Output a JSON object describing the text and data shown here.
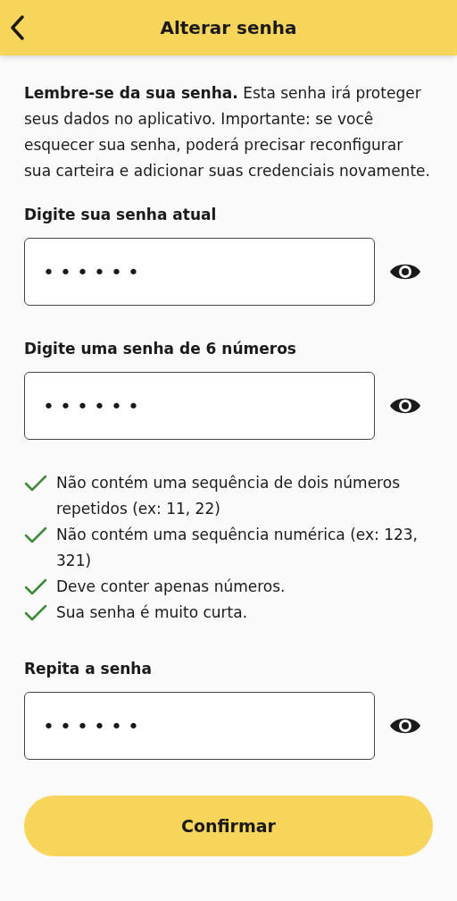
{
  "header": {
    "title": "Alterar senha"
  },
  "intro": "**Lembre-se da sua senha.** Esta senha irá proteger seus dados no aplicativo. Importante: se você esquecer sua senha, poderá precisar reconfigurar sua carteira e adicionar suas credenciais novamente.",
  "current_password": {
    "label": "Digite sua senha atual",
    "value": "••••••"
  },
  "new_password": {
    "label": "Digite uma senha de 6 números",
    "value": "••••••"
  },
  "rules": [
    {
      "text": "Não contém uma sequência de dois números repetidos (ex: 11, 22)",
      "met": true
    },
    {
      "text": "Não contém uma sequência numérica (ex: 123, 321)",
      "met": true
    },
    {
      "text": "Deve conter apenas números.",
      "met": true
    },
    {
      "text": "Sua senha é muito curta.",
      "met": true
    }
  ],
  "repeat_password": {
    "label": "Repita a senha",
    "value": "••••••"
  },
  "confirm_button": "Confirmar"
}
